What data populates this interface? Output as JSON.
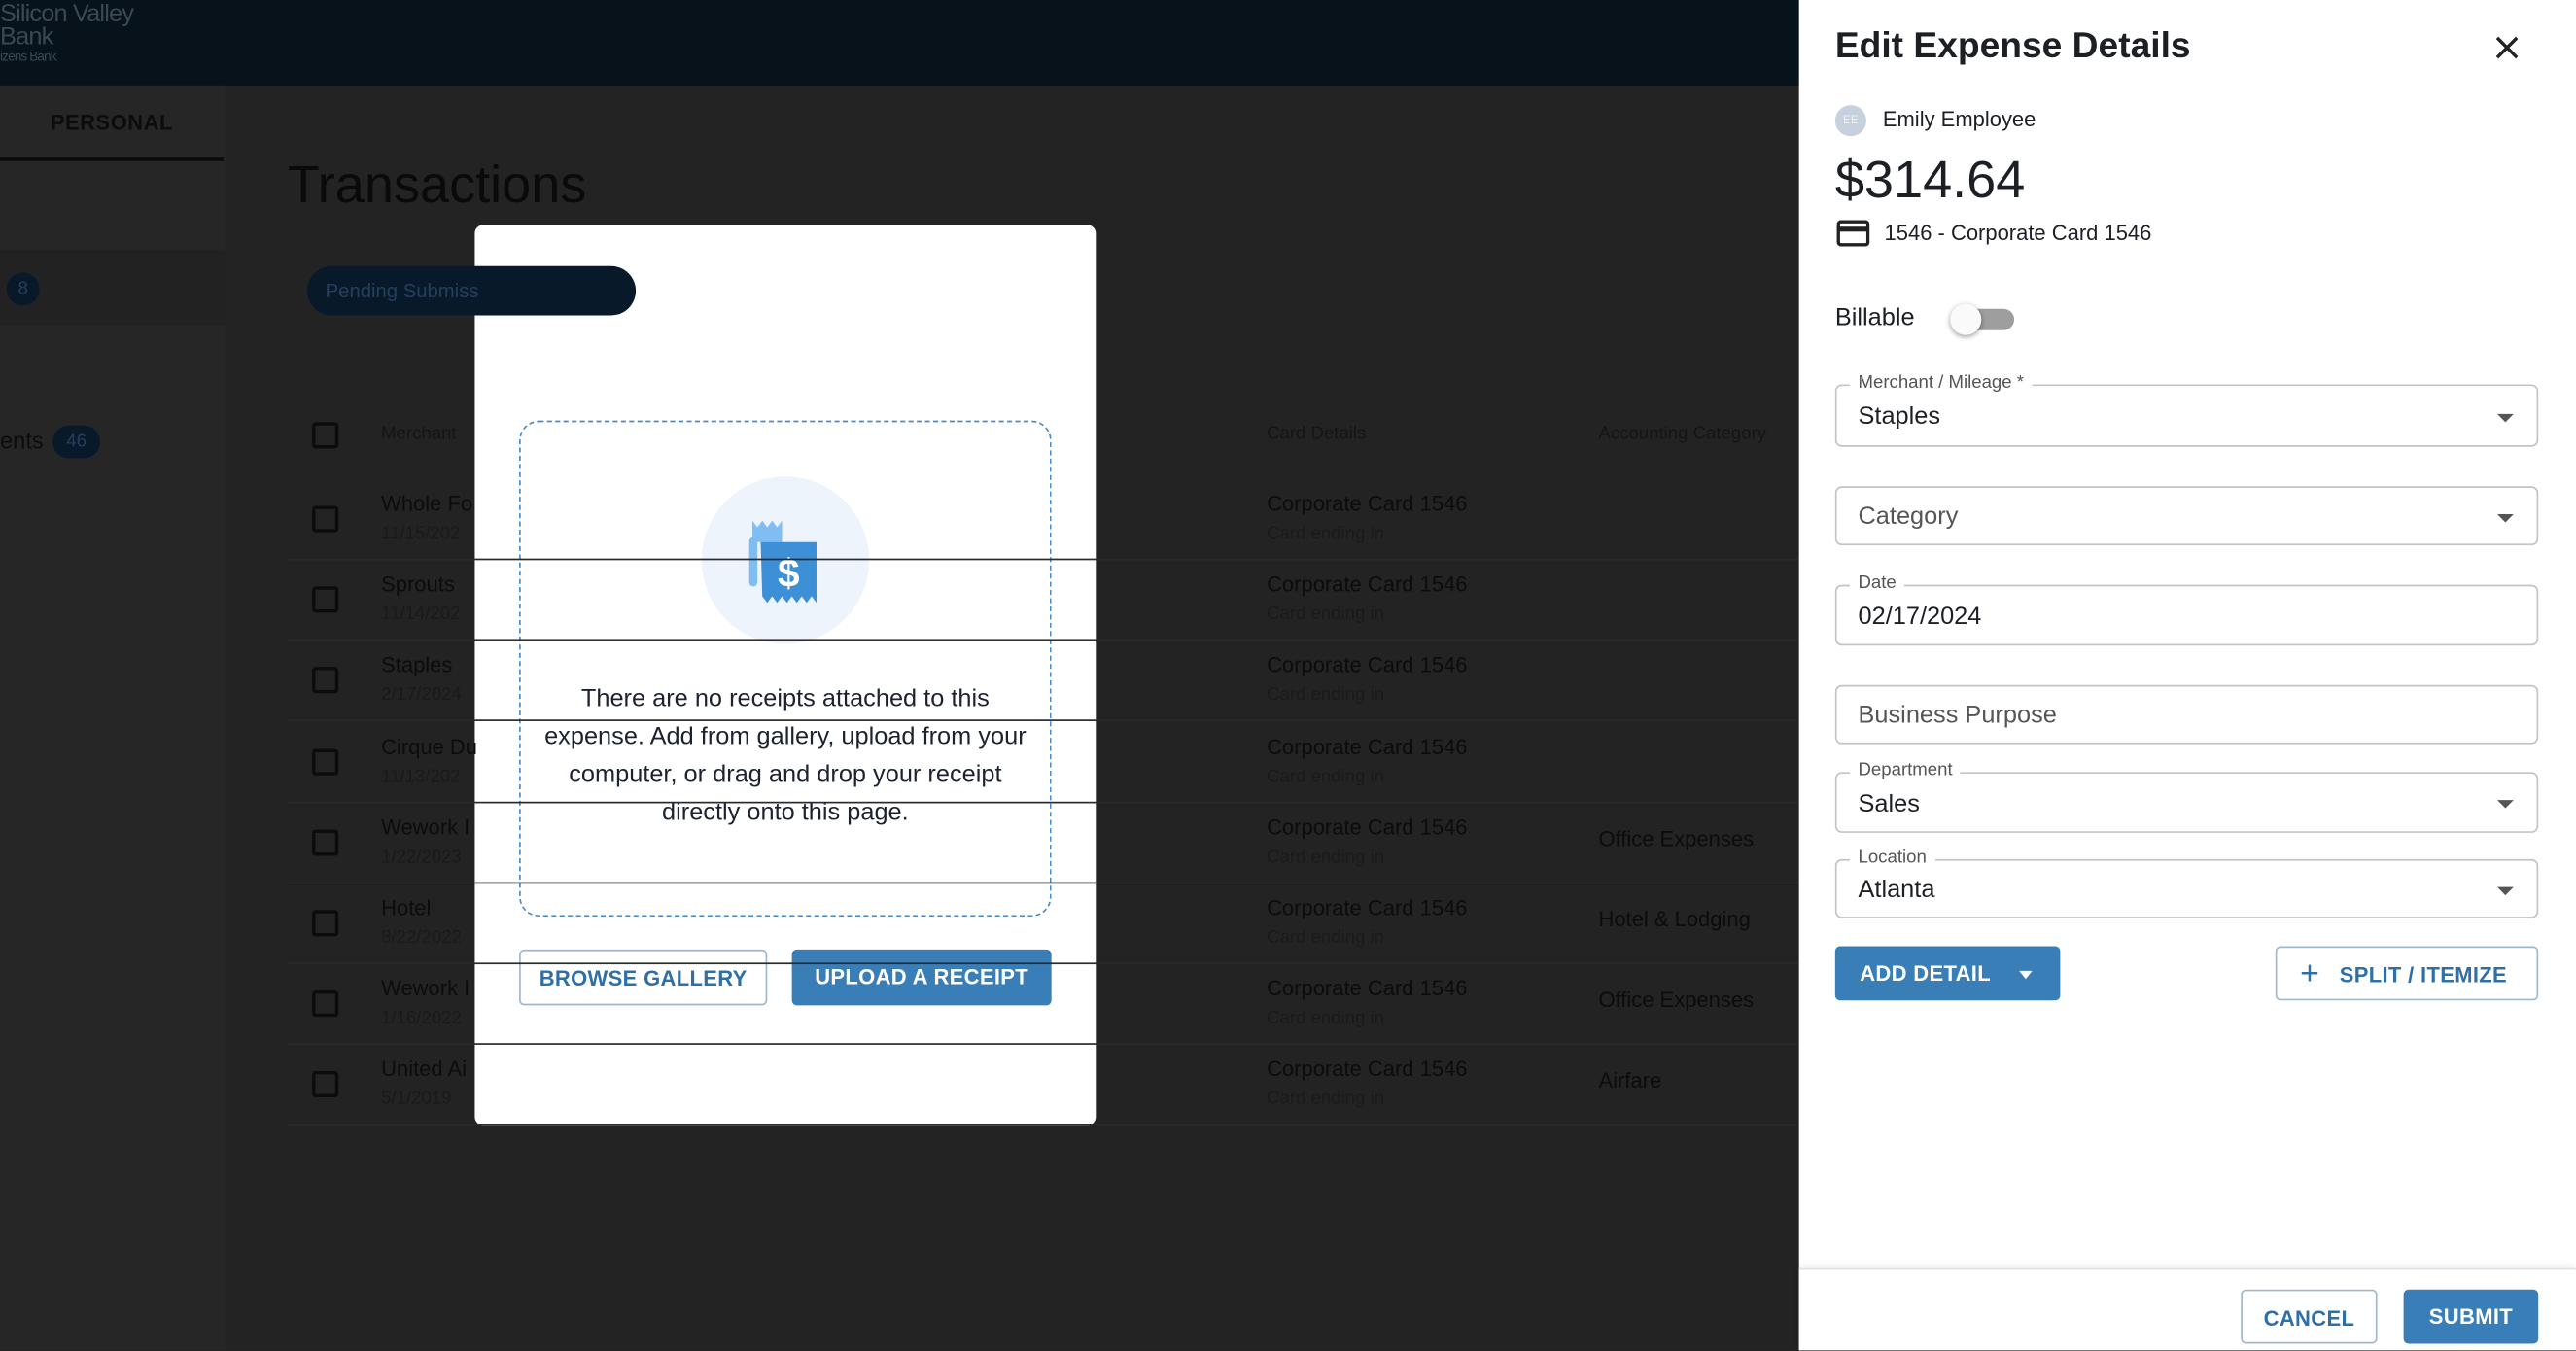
{
  "app": {
    "logo_line1": "Silicon Valley",
    "logo_line2": "Bank",
    "logo_sub": "izens Bank",
    "tab": "PERSONAL",
    "nav_badge": "8",
    "nav_item": "ents",
    "nav_item_badge": "46"
  },
  "transactions": {
    "title": "Transactions",
    "filter_pill": "Pending Submiss",
    "columns": [
      "Merchant",
      "Card Details",
      "Accounting Category"
    ],
    "rows": [
      {
        "merchant": "Whole Fo",
        "date": "11/15/202",
        "card": "Corporate Card 1546",
        "card_sub": "Card ending in",
        "category": ""
      },
      {
        "merchant": "Sprouts",
        "date": "11/14/202",
        "card": "Corporate Card 1546",
        "card_sub": "Card ending in",
        "category": ""
      },
      {
        "merchant": "Staples",
        "date": "2/17/2024",
        "card": "Corporate Card 1546",
        "card_sub": "Card ending in",
        "category": ""
      },
      {
        "merchant": "Cirque Du",
        "date": "11/13/202",
        "card": "Corporate Card 1546",
        "card_sub": "Card ending in",
        "category": ""
      },
      {
        "merchant": "Wework I",
        "date": "1/22/2023",
        "card": "Corporate Card 1546",
        "card_sub": "Card ending in",
        "category": "Office Expenses"
      },
      {
        "merchant": "Hotel",
        "date": "8/22/2022",
        "card": "Corporate Card 1546",
        "card_sub": "Card ending in",
        "category": "Hotel & Lodging"
      },
      {
        "merchant": "Wework I",
        "date": "1/16/2022",
        "card": "Corporate Card 1546",
        "card_sub": "Card ending in",
        "category": "Office Expenses"
      },
      {
        "merchant": "United Ai",
        "date": "5/1/2019",
        "card": "Corporate Card 1546",
        "card_sub": "Card ending in",
        "category": "Airfare"
      }
    ]
  },
  "receipt_modal": {
    "icon": "receipt-dollar-icon",
    "message": "There are no receipts attached to this expense. Add from gallery, upload from your computer, or drag and drop your receipt directly onto this page.",
    "browse": "BROWSE GALLERY",
    "upload": "UPLOAD A RECEIPT"
  },
  "panel": {
    "title": "Edit Expense Details",
    "avatar": "EE",
    "employee": "Emily Employee",
    "amount": "$314.64",
    "card": "1546 - Corporate Card 1546",
    "billable_label": "Billable",
    "billable_on": false,
    "fields": {
      "merchant": {
        "label": "Merchant / Mileage *",
        "value": "Staples"
      },
      "category": {
        "placeholder": "Category"
      },
      "date": {
        "label": "Date",
        "value": "02/17/2024"
      },
      "purpose": {
        "placeholder": "Business Purpose"
      },
      "department": {
        "label": "Department",
        "value": "Sales"
      },
      "location": {
        "label": "Location",
        "value": "Atlanta"
      }
    },
    "add_detail": "ADD DETAIL",
    "split": "SPLIT / ITEMIZE",
    "cancel": "CANCEL",
    "submit": "SUBMIT"
  },
  "colors": {
    "primary": "#3a7eb8",
    "header": "#07121b"
  }
}
